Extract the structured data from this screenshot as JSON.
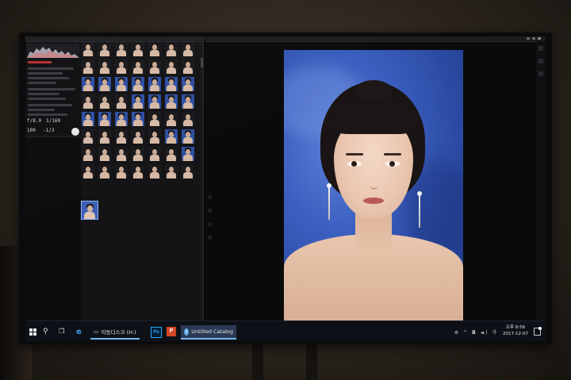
{
  "capture_panel": {
    "camera_values": [
      "f/8.0",
      "1/160",
      "100",
      "-1/3"
    ],
    "histogram_icon": "histogram-icon",
    "shutter_icon": "capture-shutter-icon"
  },
  "photo_viewer": {
    "image_subject": "portrait-photo"
  },
  "taskbar": {
    "start_icon": "windows-start-icon",
    "search_icon": "search-icon",
    "task_view_icon": "task-view-icon",
    "edge_icon": "edge-browser-icon",
    "apps": [
      {
        "label": "이동디스크 (H:)",
        "icon": "removable-drive-icon"
      },
      {
        "label": "Ps",
        "icon": "photoshop-icon"
      },
      {
        "label": "P",
        "icon": "powerpoint-icon"
      },
      {
        "label": "Untitled Catalog",
        "icon": "lightroom-icon",
        "badge": "Lr"
      }
    ],
    "tray": {
      "time": "오후 8:56",
      "date": "2017-12-07",
      "icons": "⚙ ^ ◘ ◄) 가"
    }
  },
  "colors": {
    "accent": "#76b9ed",
    "photo_background": "#3b5fc0",
    "taskbar": "#0d1117"
  }
}
